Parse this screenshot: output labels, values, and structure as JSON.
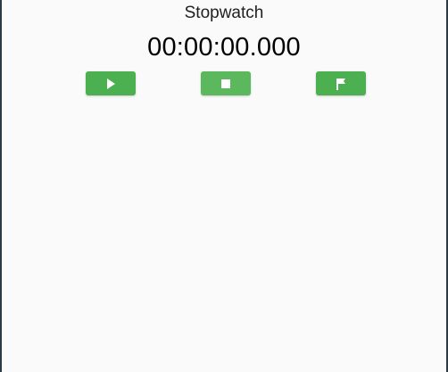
{
  "app": {
    "title": "Stopwatch"
  },
  "display": {
    "time": "00:00:00.000"
  },
  "controls": [
    {
      "id": "start",
      "icon": "play-icon",
      "color": "#4caf50"
    },
    {
      "id": "stop",
      "icon": "stop-icon",
      "color": "#5cb85c"
    },
    {
      "id": "lap",
      "icon": "flag-icon",
      "color": "#4caf50"
    }
  ],
  "colors": {
    "background": "#fafafa",
    "button_green": "#4caf50",
    "button_green_light": "#5cb85c",
    "icon": "#ffffff"
  }
}
